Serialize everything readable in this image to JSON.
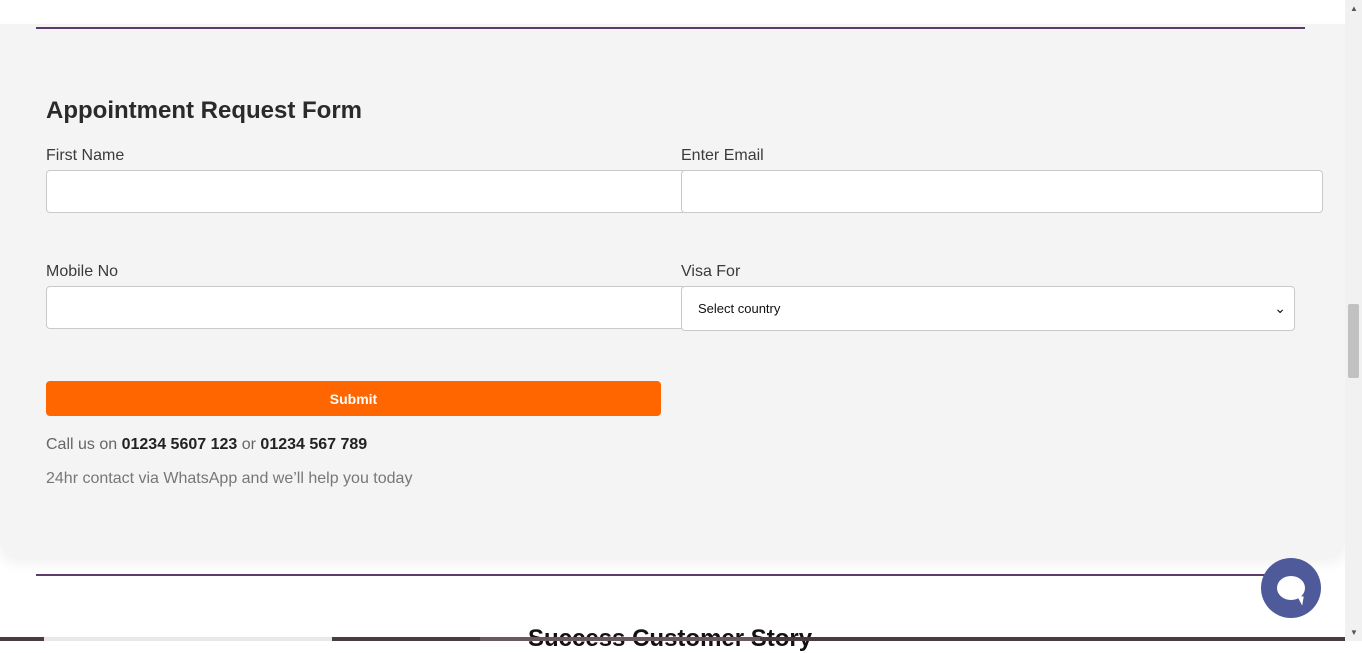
{
  "form": {
    "title": "Appointment Request Form",
    "first_name": {
      "label": "First Name",
      "value": "",
      "placeholder": ""
    },
    "email": {
      "label": "Enter Email",
      "value": "",
      "placeholder": ""
    },
    "mobile": {
      "label": "Mobile No",
      "value": "",
      "placeholder": ""
    },
    "visa": {
      "label": "Visa For",
      "selected": "Select country"
    },
    "submit_label": "Submit"
  },
  "contact": {
    "call_prefix": "Call us on",
    "phone_1": "01234 5607 123",
    "or_text": "or",
    "phone_2": "01234 567 789",
    "whatsapp_text": "24hr contact via WhatsApp and we’ll help you today"
  },
  "next_section": {
    "title": "Success Customer Story"
  },
  "colors": {
    "accent": "#ff6600",
    "divider": "#5b3a6e",
    "chat": "#4f5a9a",
    "card_bg": "#f4f4f4"
  },
  "icons": {
    "chat": "chat-bubble-icon",
    "select": "chevron-down-icon"
  }
}
